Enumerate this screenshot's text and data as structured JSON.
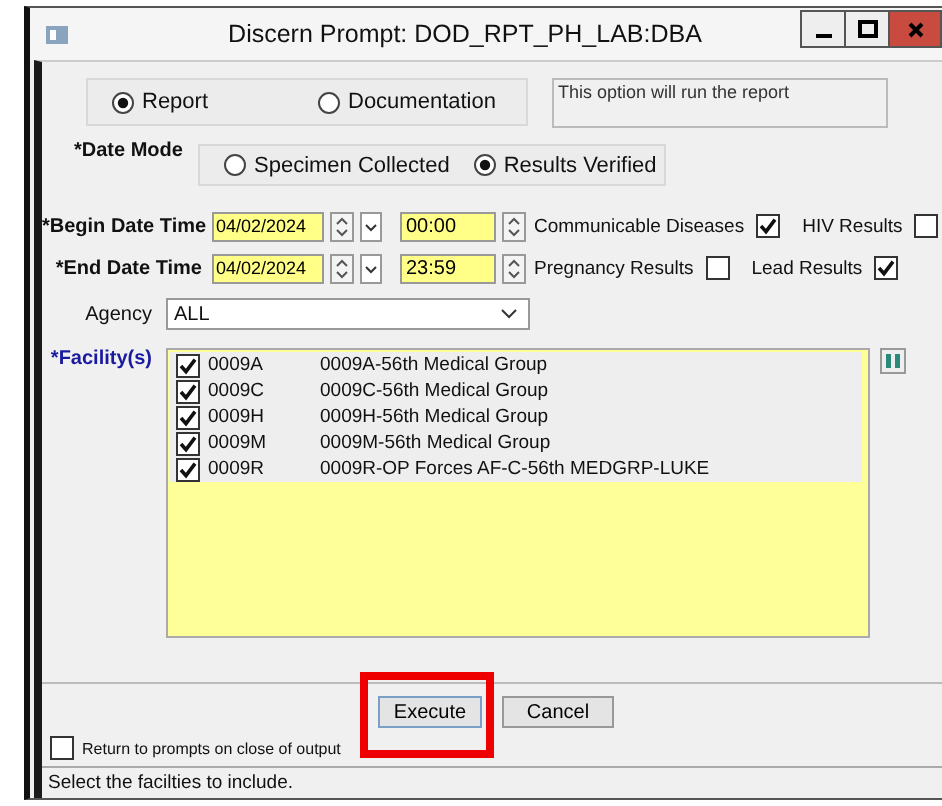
{
  "window": {
    "title": "Discern Prompt: DOD_RPT_PH_LAB:DBA"
  },
  "output_options": [
    {
      "label": "Report",
      "selected": true
    },
    {
      "label": "Documentation",
      "selected": false
    }
  ],
  "option_description": "This option will run the report",
  "date_mode": {
    "label": "*Date Mode",
    "options": [
      {
        "label": "Specimen Collected",
        "selected": false
      },
      {
        "label": "Results Verified",
        "selected": true
      }
    ]
  },
  "date_rows": [
    {
      "label": "*Begin Date Time",
      "date": "04/02/2024",
      "time": "00:00",
      "filters": [
        {
          "label": "Communicable Diseases",
          "checked": true
        },
        {
          "label": "HIV Results",
          "checked": false
        }
      ]
    },
    {
      "label": "*End Date Time",
      "date": "04/02/2024",
      "time": "23:59",
      "filters": [
        {
          "label": "Pregnancy Results",
          "checked": false
        },
        {
          "label": "Lead Results",
          "checked": true
        }
      ]
    }
  ],
  "agency": {
    "label": "Agency",
    "value": "ALL"
  },
  "facilities": {
    "label": "*Facility(s)",
    "items": [
      {
        "code": "0009A",
        "name": "0009A-56th Medical Group",
        "checked": true
      },
      {
        "code": "0009C",
        "name": "0009C-56th Medical Group",
        "checked": true
      },
      {
        "code": "0009H",
        "name": "0009H-56th Medical Group",
        "checked": true
      },
      {
        "code": "0009M",
        "name": "0009M-56th Medical Group",
        "checked": true
      },
      {
        "code": "0009R",
        "name": "0009R-OP Forces AF-C-56th MEDGRP-LUKE",
        "checked": true
      }
    ]
  },
  "buttons": [
    {
      "label": "Execute",
      "highlighted": true
    },
    {
      "label": "Cancel",
      "highlighted": false
    }
  ],
  "return_to_prompts": {
    "label": "Return to prompts on close of output",
    "checked": false
  },
  "status_bar": "Select the facilties to include."
}
